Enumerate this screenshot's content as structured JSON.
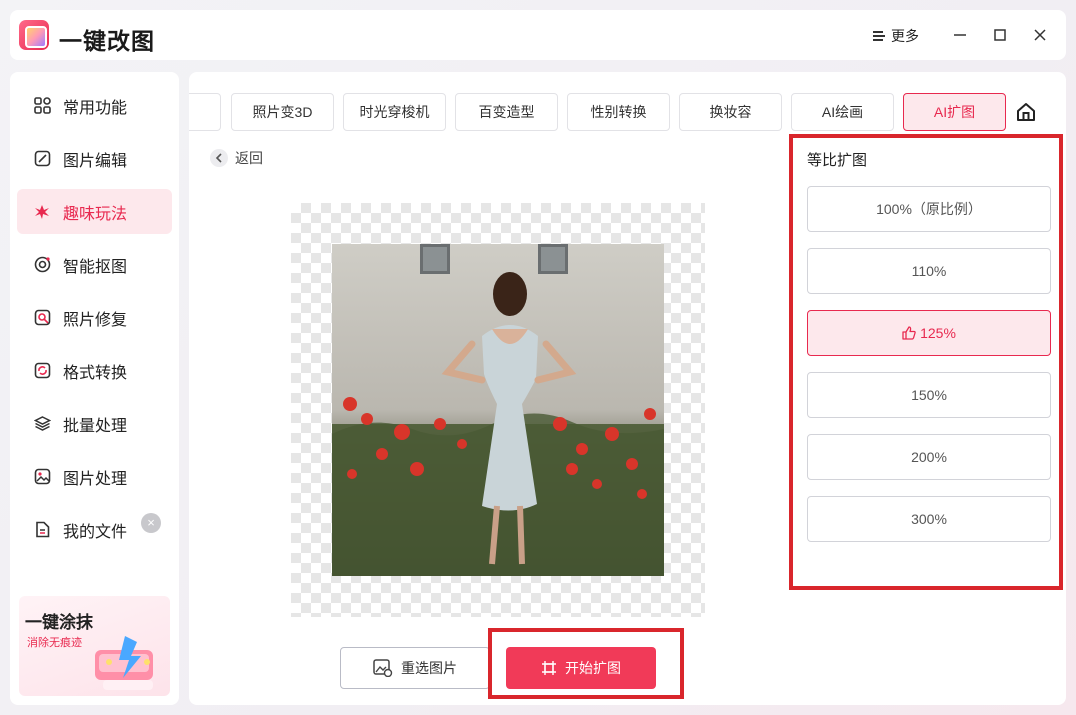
{
  "app": {
    "title": "一键改图"
  },
  "titlebar": {
    "more_label": "更多"
  },
  "sidebar": {
    "items": [
      {
        "label": "常用功能",
        "icon": "grid-icon"
      },
      {
        "label": "图片编辑",
        "icon": "edit-icon"
      },
      {
        "label": "趣味玩法",
        "icon": "splash-icon",
        "active": true
      },
      {
        "label": "智能抠图",
        "icon": "target-icon"
      },
      {
        "label": "照片修复",
        "icon": "repair-icon"
      },
      {
        "label": "格式转换",
        "icon": "convert-icon"
      },
      {
        "label": "批量处理",
        "icon": "layers-icon"
      },
      {
        "label": "图片处理",
        "icon": "image-icon"
      },
      {
        "label": "我的文件",
        "icon": "file-icon"
      }
    ],
    "promo": {
      "title": "一键涂抹",
      "subtitle": "消除无痕迹",
      "close": "×"
    }
  },
  "tabs": [
    "照片变3D",
    "时光穿梭机",
    "百变造型",
    "性别转换",
    "换妆容",
    "AI绘画",
    "AI扩图"
  ],
  "active_tab": "AI扩图",
  "back_label": "返回",
  "ratio_panel": {
    "title": "等比扩图",
    "options": [
      "100%（原比例）",
      "110%",
      "125%",
      "150%",
      "200%",
      "300%"
    ],
    "selected": "125%"
  },
  "buttons": {
    "reselect": "重选图片",
    "start": "开始扩图"
  },
  "colors": {
    "accent": "#e8294f",
    "start_button": "#f13a58",
    "highlight_box": "#d9262c",
    "selected_bg": "#fde8ec"
  }
}
